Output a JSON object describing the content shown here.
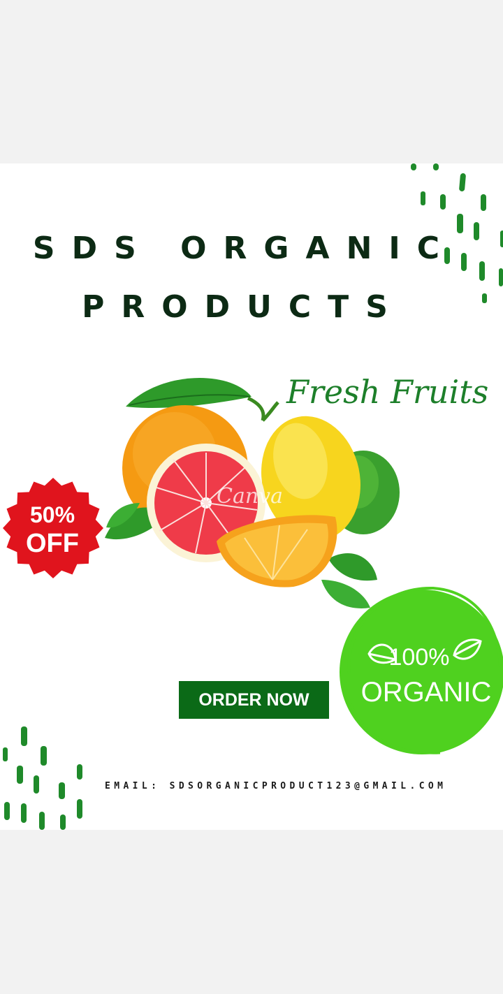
{
  "brand": {
    "title_line1": "SDS ORGANIC",
    "title_line2": "PRODUCTS"
  },
  "headline": "Fresh Fruits",
  "discount": {
    "line1": "50%",
    "line2": "OFF"
  },
  "organic": {
    "line1": "100%",
    "line2": "ORGANIC"
  },
  "cta": {
    "label": "ORDER NOW"
  },
  "contact": {
    "email_text": "EMAIL: SDSORGANICPRODUCT123@GMAIL.COM"
  },
  "watermark": "Canva",
  "colors": {
    "brand_green": "#0b6a17",
    "accent_green": "#1d7f2a",
    "organic_green": "#4fd11f",
    "sale_red": "#e0141d"
  },
  "icons": [
    "leaf-icon",
    "fruit-illustration",
    "dash-pattern"
  ]
}
